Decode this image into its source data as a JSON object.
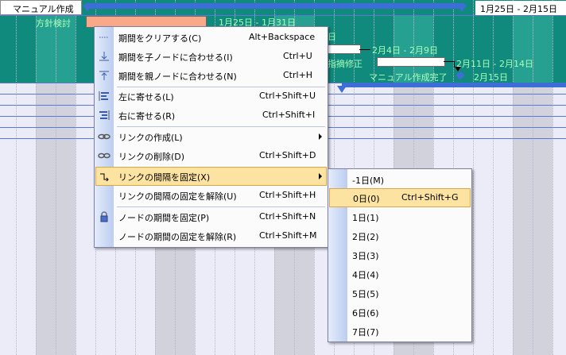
{
  "gantt": {
    "rows": [
      {
        "label": "マニュアル作成",
        "range": "1月25日 - 2月15日"
      },
      {
        "label": "方針検討",
        "range": "1月25日 - 1月31日"
      },
      {
        "label": "",
        "range": "2月4日 - 2月9日"
      },
      {
        "label": "指摘修正",
        "range": "2月11日 - 2月14日"
      },
      {
        "label": "マニュアル作成完了",
        "range": "2月15日"
      }
    ],
    "fragment_top": "日",
    "colors": {
      "teal": "#0f8a7c",
      "teal_alt": "#149080",
      "label_green": "#a8ffb8",
      "summary_blue": "#3d6ed6",
      "bar_orange": "#f9a888"
    }
  },
  "context_menu": {
    "items": [
      {
        "label": "期間をクリアする(C)",
        "shortcut": "Alt+Backspace",
        "icon": "clear-period-icon"
      },
      {
        "label": "期間を子ノードに合わせる(I)",
        "shortcut": "Ctrl+U",
        "icon": "fit-child-icon"
      },
      {
        "label": "期間を親ノードに合わせる(N)",
        "shortcut": "Ctrl+H",
        "icon": "fit-parent-icon"
      },
      {
        "label": "左に寄せる(L)",
        "shortcut": "Ctrl+Shift+U",
        "icon": "align-left-icon"
      },
      {
        "label": "右に寄せる(R)",
        "shortcut": "Ctrl+Shift+I",
        "icon": "align-right-icon"
      },
      {
        "label": "リンクの作成(L)",
        "shortcut": "",
        "icon": "create-link-icon",
        "submenu": true
      },
      {
        "label": "リンクの削除(D)",
        "shortcut": "Ctrl+Shift+D",
        "icon": "delete-link-icon"
      },
      {
        "label": "リンクの間隔を固定(X)",
        "shortcut": "",
        "icon": "fix-link-interval-icon",
        "submenu": true,
        "highlighted": true
      },
      {
        "label": "リンクの間隔の固定を解除(U)",
        "shortcut": "Ctrl+Shift+H",
        "icon": ""
      },
      {
        "label": "ノードの期間を固定(P)",
        "shortcut": "Ctrl+Shift+N",
        "icon": "lock-icon"
      },
      {
        "label": "ノードの期間の固定を解除(R)",
        "shortcut": "Ctrl+Shift+M",
        "icon": ""
      }
    ]
  },
  "submenu": {
    "items": [
      {
        "label": "-1日(M)",
        "shortcut": ""
      },
      {
        "label": "0日(0)",
        "shortcut": "Ctrl+Shift+G",
        "highlighted": true
      },
      {
        "label": "1日(1)",
        "shortcut": ""
      },
      {
        "label": "2日(2)",
        "shortcut": ""
      },
      {
        "label": "3日(3)",
        "shortcut": ""
      },
      {
        "label": "4日(4)",
        "shortcut": ""
      },
      {
        "label": "5日(5)",
        "shortcut": ""
      },
      {
        "label": "6日(6)",
        "shortcut": ""
      },
      {
        "label": "7日(7)",
        "shortcut": ""
      }
    ]
  }
}
